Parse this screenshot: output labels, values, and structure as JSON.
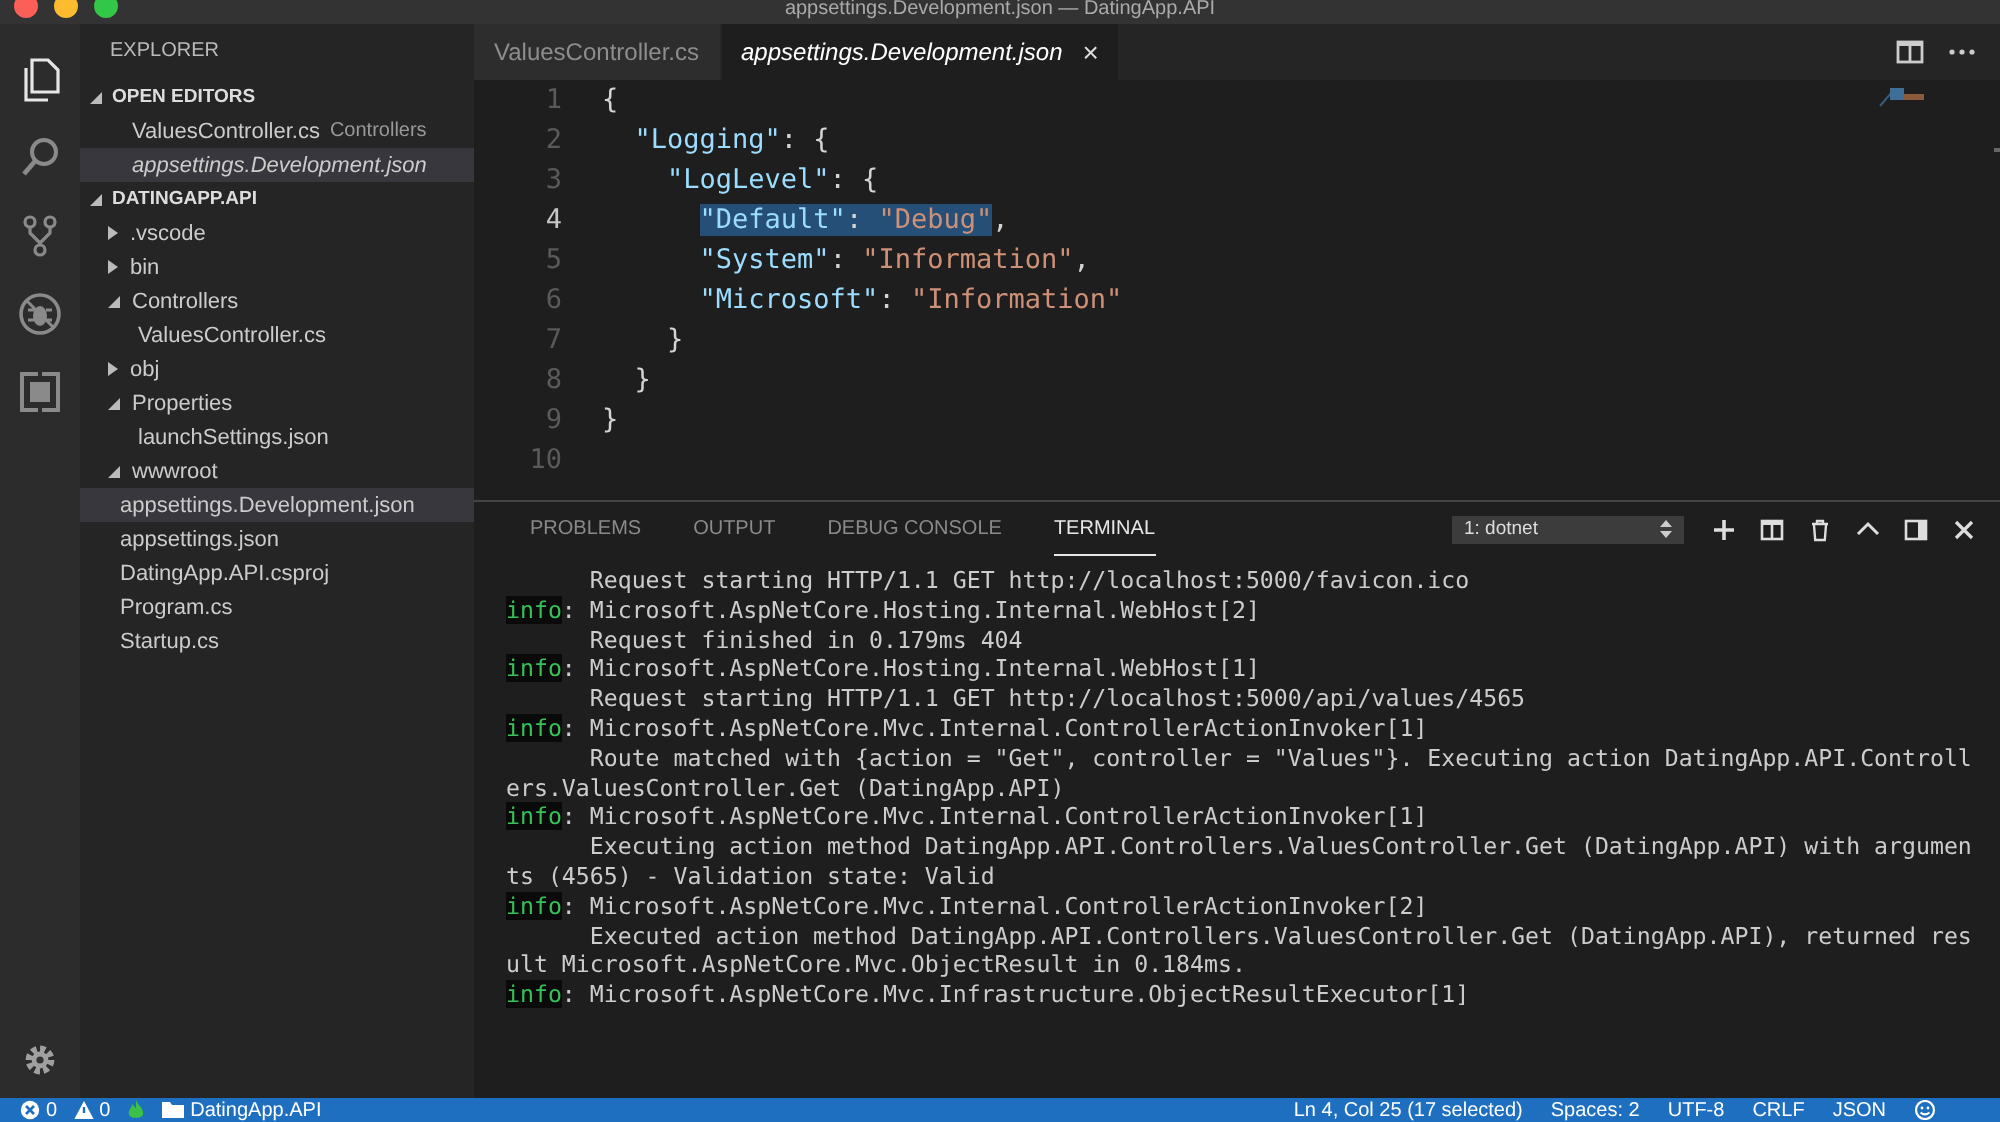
{
  "window": {
    "title": "appsettings.Development.json — DatingApp.API"
  },
  "activity_bar": {
    "items": [
      {
        "kind": "files",
        "selected": true
      },
      {
        "kind": "search",
        "selected": false
      },
      {
        "kind": "source-control",
        "selected": false
      },
      {
        "kind": "debug",
        "selected": false
      },
      {
        "kind": "extensions",
        "selected": false
      }
    ]
  },
  "sidebar": {
    "title": "EXPLORER",
    "sections": [
      {
        "title": "OPEN EDITORS",
        "expanded": true,
        "items": [
          {
            "label": "ValuesController.cs",
            "description": "Controllers",
            "italic": false,
            "selected": false
          },
          {
            "label": "appsettings.Development.json",
            "italic": true,
            "selected": true
          }
        ]
      },
      {
        "title": "DATINGAPP.API",
        "expanded": true,
        "items": [
          {
            "label": ".vscode",
            "folder": true,
            "expanded": false,
            "selected": false
          },
          {
            "label": "bin",
            "folder": true,
            "expanded": false,
            "selected": false
          },
          {
            "label": "Controllers",
            "folder": true,
            "expanded": true,
            "selected": false,
            "children": [
              {
                "label": "ValuesController.cs",
                "folder": false,
                "selected": false
              }
            ]
          },
          {
            "label": "obj",
            "folder": true,
            "expanded": false,
            "selected": false
          },
          {
            "label": "Properties",
            "folder": true,
            "expanded": true,
            "selected": false,
            "children": [
              {
                "label": "launchSettings.json",
                "folder": false,
                "selected": false
              }
            ]
          },
          {
            "label": "wwwroot",
            "folder": true,
            "expanded": true,
            "selected": false
          },
          {
            "label": "appsettings.Development.json",
            "folder": false,
            "selected": true
          },
          {
            "label": "appsettings.json",
            "folder": false,
            "selected": false
          },
          {
            "label": "DatingApp.API.csproj",
            "folder": false,
            "selected": false
          },
          {
            "label": "Program.cs",
            "folder": false,
            "selected": false
          },
          {
            "label": "Startup.cs",
            "folder": false,
            "selected": false
          }
        ]
      }
    ]
  },
  "editor": {
    "tabs": [
      {
        "label": "ValuesController.cs",
        "italic": false,
        "selected": false
      },
      {
        "label": "appsettings.Development.json",
        "italic": true,
        "selected": true,
        "close": "×"
      }
    ],
    "lines": [
      {
        "number": "1",
        "current": false,
        "tokens": [
          {
            "kind": "punct",
            "text": "{",
            "selected": false
          }
        ]
      },
      {
        "number": "2",
        "current": false,
        "tokens": [
          {
            "kind": "key",
            "text": "  \"Logging\"",
            "selected": false
          },
          {
            "kind": "punct",
            "text": ": {",
            "selected": false
          }
        ]
      },
      {
        "number": "3",
        "current": false,
        "tokens": [
          {
            "kind": "key",
            "text": "    \"LogLevel\"",
            "selected": false
          },
          {
            "kind": "punct",
            "text": ": {",
            "selected": false
          }
        ]
      },
      {
        "number": "4",
        "current": true,
        "tokens": [
          {
            "kind": "key",
            "text": "      \"Default\"",
            "selected": true
          },
          {
            "kind": "punct",
            "text": ": ",
            "selected": true
          },
          {
            "kind": "string",
            "text": "\"Debug\"",
            "selected": true
          },
          {
            "kind": "punct",
            "text": ",",
            "selected": false
          }
        ]
      },
      {
        "number": "5",
        "current": false,
        "tokens": [
          {
            "kind": "key",
            "text": "      \"System\"",
            "selected": false
          },
          {
            "kind": "punct",
            "text": ": ",
            "selected": false
          },
          {
            "kind": "string",
            "text": "\"Information\"",
            "selected": false
          },
          {
            "kind": "punct",
            "text": ",",
            "selected": false
          }
        ]
      },
      {
        "number": "6",
        "current": false,
        "tokens": [
          {
            "kind": "key",
            "text": "      \"Microsoft\"",
            "selected": false
          },
          {
            "kind": "punct",
            "text": ": ",
            "selected": false
          },
          {
            "kind": "string",
            "text": "\"Information\"",
            "selected": false
          }
        ]
      },
      {
        "number": "7",
        "current": false,
        "tokens": [
          {
            "kind": "punct",
            "text": "    }",
            "selected": false
          }
        ]
      },
      {
        "number": "8",
        "current": false,
        "tokens": [
          {
            "kind": "punct",
            "text": "  }",
            "selected": false
          }
        ]
      },
      {
        "number": "9",
        "current": false,
        "tokens": [
          {
            "kind": "punct",
            "text": "}",
            "selected": false
          }
        ]
      },
      {
        "number": "10",
        "current": false
      }
    ]
  },
  "panel": {
    "tabs": [
      {
        "label": "PROBLEMS",
        "selected": false
      },
      {
        "label": "OUTPUT",
        "selected": false
      },
      {
        "label": "DEBUG CONSOLE",
        "selected": false
      },
      {
        "label": "TERMINAL",
        "selected": true
      }
    ],
    "terminal_select": "1: dotnet",
    "lines": [
      {
        "kind": "plain",
        "text": "      Request starting HTTP/1.1 GET http://localhost:5000/favicon.ico"
      },
      {
        "kind": "info",
        "label": "info",
        "text": ": Microsoft.AspNetCore.Hosting.Internal.WebHost[2]"
      },
      {
        "kind": "plain",
        "text": "      Request finished in 0.179ms 404"
      },
      {
        "kind": "info",
        "label": "info",
        "text": ": Microsoft.AspNetCore.Hosting.Internal.WebHost[1]"
      },
      {
        "kind": "plain",
        "text": "      Request starting HTTP/1.1 GET http://localhost:5000/api/values/4565"
      },
      {
        "kind": "info",
        "label": "info",
        "text": ": Microsoft.AspNetCore.Mvc.Internal.ControllerActionInvoker[1]"
      },
      {
        "kind": "plain",
        "text": "      Route matched with {action = \"Get\", controller = \"Values\"}. Executing action DatingApp.API.Controll"
      },
      {
        "kind": "plain",
        "text": "ers.ValuesController.Get (DatingApp.API)"
      },
      {
        "kind": "info",
        "label": "info",
        "text": ": Microsoft.AspNetCore.Mvc.Internal.ControllerActionInvoker[1]"
      },
      {
        "kind": "plain",
        "text": "      Executing action method DatingApp.API.Controllers.ValuesController.Get (DatingApp.API) with argumen"
      },
      {
        "kind": "plain",
        "text": "ts (4565) - Validation state: Valid"
      },
      {
        "kind": "info",
        "label": "info",
        "text": ": Microsoft.AspNetCore.Mvc.Internal.ControllerActionInvoker[2]"
      },
      {
        "kind": "plain",
        "text": "      Executed action method DatingApp.API.Controllers.ValuesController.Get (DatingApp.API), returned res"
      },
      {
        "kind": "plain",
        "text": "ult Microsoft.AspNetCore.Mvc.ObjectResult in 0.184ms."
      },
      {
        "kind": "info",
        "label": "info",
        "text": ": Microsoft.AspNetCore.Mvc.Infrastructure.ObjectResultExecutor[1]"
      }
    ]
  },
  "status_bar": {
    "left": [
      {
        "kind": "errors",
        "text": "0"
      },
      {
        "kind": "warnings",
        "text": "0"
      },
      {
        "kind": "flame"
      },
      {
        "kind": "folder",
        "text": "DatingApp.API"
      }
    ],
    "right": [
      {
        "kind": "text",
        "text": "Ln 4, Col 25 (17 selected)"
      },
      {
        "kind": "text",
        "text": "Spaces: 2"
      },
      {
        "kind": "text",
        "text": "UTF-8"
      },
      {
        "kind": "text",
        "text": "CRLF"
      },
      {
        "kind": "text",
        "text": "JSON"
      },
      {
        "kind": "smiley"
      }
    ]
  }
}
